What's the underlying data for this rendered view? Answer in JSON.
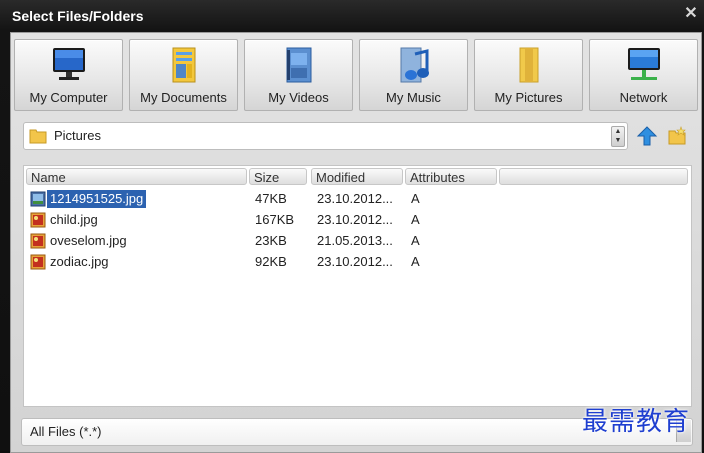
{
  "window": {
    "title": "Select Files/Folders",
    "close_glyph": "✕"
  },
  "quick_access": [
    {
      "label": "My Computer",
      "icon": "monitor-icon"
    },
    {
      "label": "My Documents",
      "icon": "documents-icon"
    },
    {
      "label": "My Videos",
      "icon": "videos-icon"
    },
    {
      "label": "My Music",
      "icon": "music-icon"
    },
    {
      "label": "My Pictures",
      "icon": "pictures-folder-icon"
    },
    {
      "label": "Network",
      "icon": "network-icon"
    }
  ],
  "path": {
    "current": "Pictures"
  },
  "columns": {
    "name": "Name",
    "size": "Size",
    "modified": "Modified",
    "attributes": "Attributes"
  },
  "files": [
    {
      "name": "1214951525.jpg",
      "size": "47KB",
      "modified": "23.10.2012...",
      "attributes": "A",
      "selected": true
    },
    {
      "name": "child.jpg",
      "size": "167KB",
      "modified": "23.10.2012...",
      "attributes": "A",
      "selected": false
    },
    {
      "name": "oveselom.jpg",
      "size": "23KB",
      "modified": "21.05.2013...",
      "attributes": "A",
      "selected": false
    },
    {
      "name": "zodiac.jpg",
      "size": "92KB",
      "modified": "23.10.2012...",
      "attributes": "A",
      "selected": false
    }
  ],
  "filter": {
    "value": "All Files (*.*)"
  },
  "watermark": "最需教育",
  "colors": {
    "selection": "#2c62b0",
    "titlebar": "#1a1a1a",
    "watermark": "#1f3fd0"
  }
}
